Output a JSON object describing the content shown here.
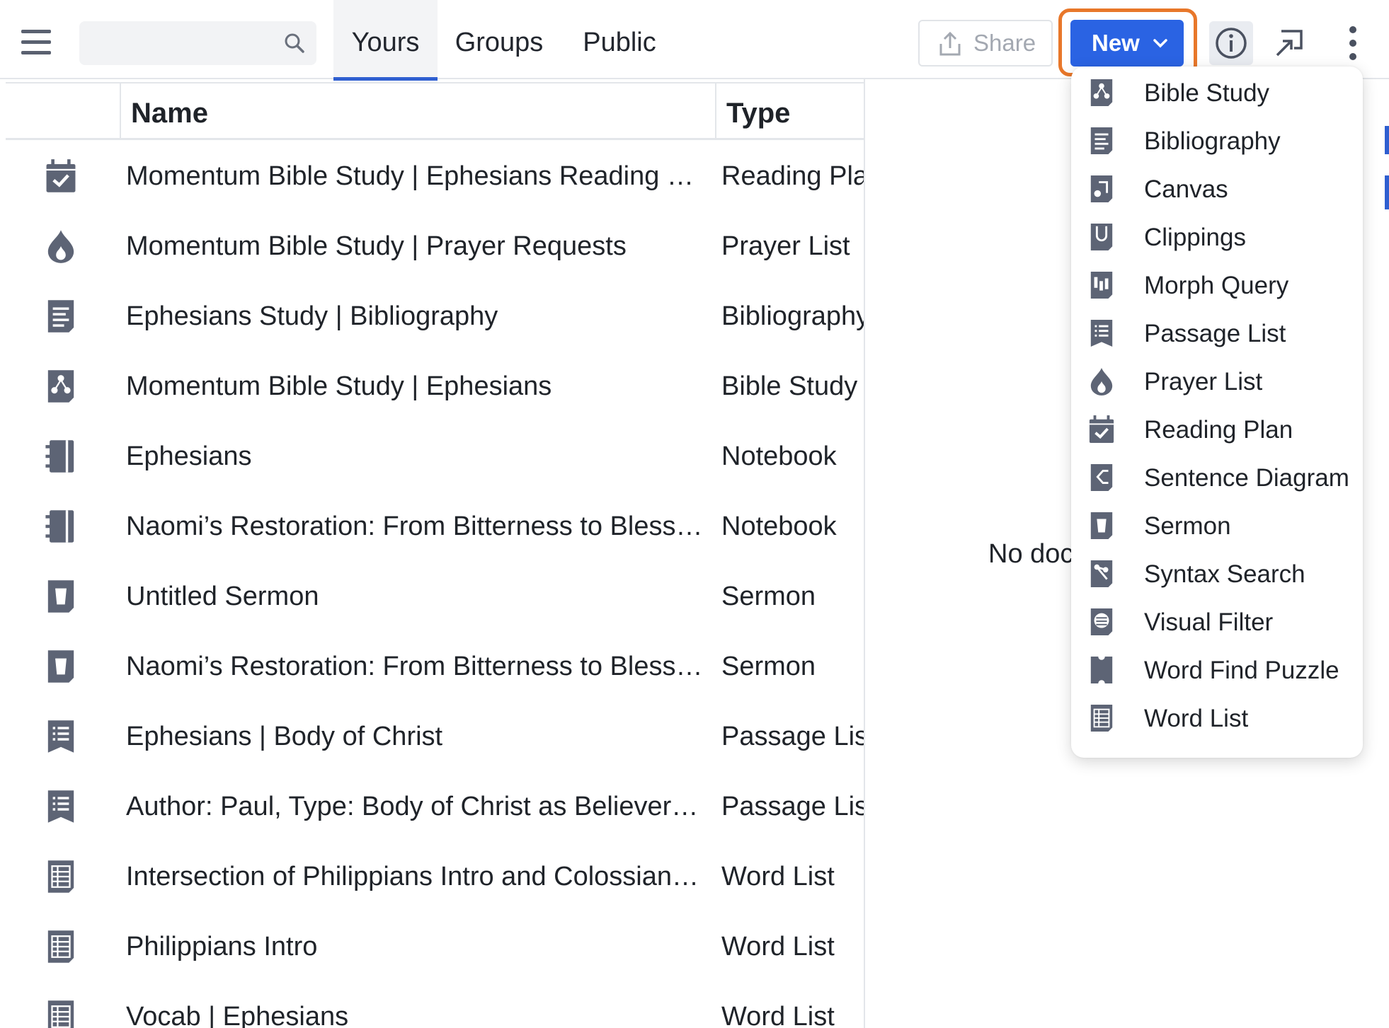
{
  "toolbar": {
    "search_placeholder": "",
    "tabs": [
      {
        "label": "Yours",
        "active": true
      },
      {
        "label": "Groups",
        "active": false
      },
      {
        "label": "Public",
        "active": false
      }
    ],
    "share_label": "Share",
    "new_label": "New",
    "icons": [
      "menu-icon",
      "search-icon",
      "share-icon",
      "chevron-down-icon",
      "info-icon",
      "cast-icon",
      "more-vertical-icon"
    ]
  },
  "table": {
    "headers": {
      "name": "Name",
      "type": "Type"
    },
    "rows": [
      {
        "name": "Momentum Bible Study | Ephesians Reading Plan",
        "type": "Reading Plan",
        "icon": "reading-plan-icon"
      },
      {
        "name": "Momentum Bible Study | Prayer Requests",
        "type": "Prayer List",
        "icon": "prayer-list-icon"
      },
      {
        "name": "Ephesians Study | Bibliography",
        "type": "Bibliography",
        "icon": "bibliography-icon"
      },
      {
        "name": "Momentum Bible Study | Ephesians",
        "type": "Bible Study",
        "icon": "bible-study-icon"
      },
      {
        "name": "Ephesians",
        "type": "Notebook",
        "icon": "notebook-icon"
      },
      {
        "name": "Naomi’s Restoration: From Bitterness to Blessing",
        "type": "Notebook",
        "icon": "notebook-icon"
      },
      {
        "name": "Untitled Sermon",
        "type": "Sermon",
        "icon": "sermon-icon"
      },
      {
        "name": "Naomi’s Restoration: From Bitterness to Blessing",
        "type": "Sermon",
        "icon": "sermon-icon"
      },
      {
        "name": "Ephesians | Body of Christ",
        "type": "Passage List",
        "icon": "passage-list-icon"
      },
      {
        "name": "Author: Paul, Type: Body of Christ as Believers,…",
        "type": "Passage List",
        "icon": "passage-list-icon"
      },
      {
        "name": "Intersection of Philippians Intro and Colossian…",
        "type": "Word List",
        "icon": "word-list-icon"
      },
      {
        "name": "Philippians Intro",
        "type": "Word List",
        "icon": "word-list-icon"
      },
      {
        "name": "Vocab | Ephesians",
        "type": "Word List",
        "icon": "word-list-icon"
      }
    ]
  },
  "detail": {
    "empty_text": "No doc"
  },
  "new_menu": {
    "items": [
      {
        "label": "Bible Study",
        "icon": "bible-study-icon"
      },
      {
        "label": "Bibliography",
        "icon": "bibliography-icon"
      },
      {
        "label": "Canvas",
        "icon": "canvas-icon"
      },
      {
        "label": "Clippings",
        "icon": "clippings-icon"
      },
      {
        "label": "Morph Query",
        "icon": "morph-query-icon"
      },
      {
        "label": "Passage List",
        "icon": "passage-list-icon"
      },
      {
        "label": "Prayer List",
        "icon": "prayer-list-icon"
      },
      {
        "label": "Reading Plan",
        "icon": "reading-plan-icon"
      },
      {
        "label": "Sentence Diagram",
        "icon": "sentence-diagram-icon"
      },
      {
        "label": "Sermon",
        "icon": "sermon-icon"
      },
      {
        "label": "Syntax Search",
        "icon": "syntax-search-icon"
      },
      {
        "label": "Visual Filter",
        "icon": "visual-filter-icon"
      },
      {
        "label": "Word Find Puzzle",
        "icon": "word-find-puzzle-icon"
      },
      {
        "label": "Word List",
        "icon": "word-list-icon"
      }
    ]
  },
  "colors": {
    "accent": "#2a63e3",
    "highlight_ring": "#e8772a",
    "icon_gray": "#5d6475",
    "text": "#1f2329"
  }
}
